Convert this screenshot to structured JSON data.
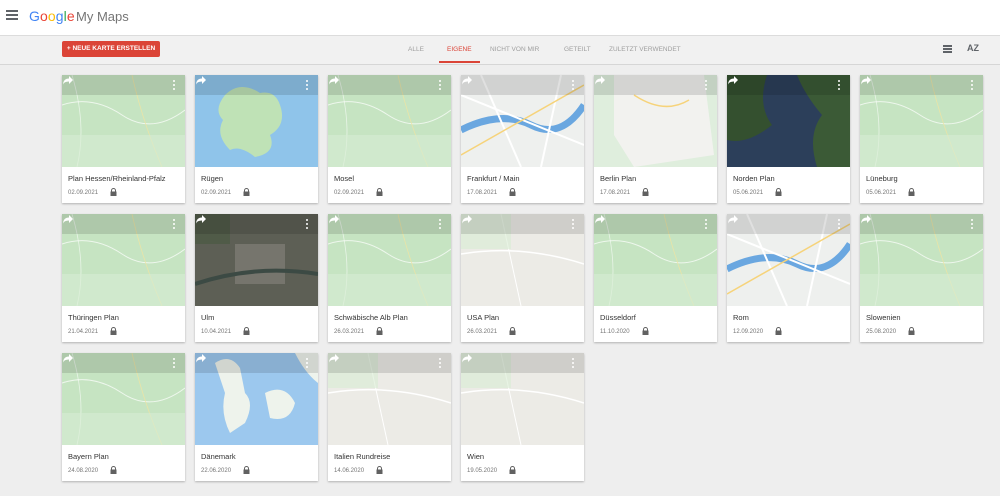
{
  "header": {
    "logo_letters": [
      {
        "char": "G",
        "color": "#4285f4"
      },
      {
        "char": "o",
        "color": "#ea4335"
      },
      {
        "char": "o",
        "color": "#fbbc05"
      },
      {
        "char": "g",
        "color": "#4285f4"
      },
      {
        "char": "l",
        "color": "#34a853"
      },
      {
        "char": "e",
        "color": "#ea4335"
      }
    ],
    "app_name": "My Maps",
    "menu_icon": "hamburger-menu-icon"
  },
  "toolbar": {
    "create_label": "+ NEUE KARTE ERSTELLEN",
    "tabs": [
      {
        "label": "ALLE",
        "active": false
      },
      {
        "label": "EIGENE",
        "active": true
      },
      {
        "label": "NICHT VON MIR",
        "active": false
      },
      {
        "label": "GETEILT",
        "active": false
      },
      {
        "label": "ZULETZT VERWENDET",
        "active": false
      }
    ],
    "list_view_icon": "list-view-icon",
    "sort_label": "AZ",
    "accent_color": "#db4437"
  },
  "maps": [
    {
      "title": "Plan Hessen/Rheinland-Pfalz",
      "date": "02.09.2021",
      "thumb": "green"
    },
    {
      "title": "Rügen",
      "date": "02.09.2021",
      "thumb": "island"
    },
    {
      "title": "Mosel",
      "date": "02.09.2021",
      "thumb": "green"
    },
    {
      "title": "Frankfurt / Main",
      "date": "17.08.2021",
      "thumb": "city"
    },
    {
      "title": "Berlin Plan",
      "date": "17.08.2021",
      "thumb": "berlin"
    },
    {
      "title": "Norden Plan",
      "date": "05.06.2021",
      "thumb": "dark"
    },
    {
      "title": "Lüneburg",
      "date": "05.06.2021",
      "thumb": "green"
    },
    {
      "title": "Thüringen Plan",
      "date": "21.04.2021",
      "thumb": "green"
    },
    {
      "title": "Ulm",
      "date": "10.04.2021",
      "thumb": "satellite"
    },
    {
      "title": "Schwäbische Alb Plan",
      "date": "26.03.2021",
      "thumb": "green"
    },
    {
      "title": "USA Plan",
      "date": "26.03.2021",
      "thumb": "beige"
    },
    {
      "title": "Düsseldorf",
      "date": "11.10.2020",
      "thumb": "green"
    },
    {
      "title": "Rom",
      "date": "12.09.2020",
      "thumb": "city"
    },
    {
      "title": "Slowenien",
      "date": "25.08.2020",
      "thumb": "green"
    },
    {
      "title": "Bayern Plan",
      "date": "24.08.2020",
      "thumb": "green"
    },
    {
      "title": "Dänemark",
      "date": "22.06.2020",
      "thumb": "denmark"
    },
    {
      "title": "Italien Rundreise",
      "date": "14.06.2020",
      "thumb": "beige"
    },
    {
      "title": "Wien",
      "date": "19.05.2020",
      "thumb": "beige"
    }
  ],
  "card_icons": {
    "share": "share-arrow-icon",
    "more": "more-vert-icon",
    "lock": "lock-icon"
  },
  "thumb_colors": {
    "green": "#c6e4c2",
    "island": "#8fc4ea",
    "city": "#eef0ee",
    "berlin": "#dfeedd",
    "dark": "#2c3f5a",
    "satellite": "#5d5f55",
    "beige": "#ecebe6",
    "denmark": "#9cc8ee"
  }
}
